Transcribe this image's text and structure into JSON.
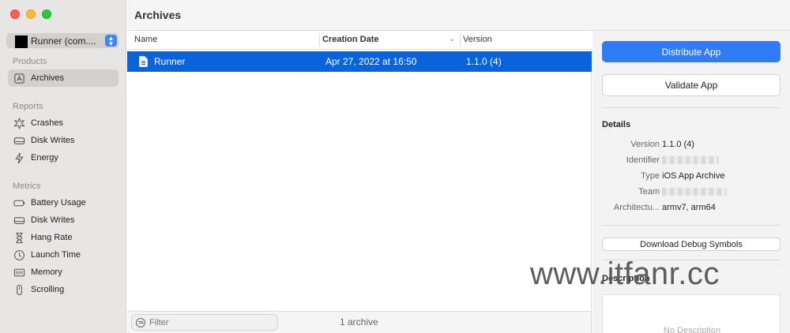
{
  "window": {
    "title": "Archives"
  },
  "sidebar": {
    "app_selector": {
      "name": "Runner (com...."
    },
    "sections": {
      "products": "Products",
      "reports": "Reports",
      "metrics": "Metrics"
    },
    "products_items": [
      {
        "label": "Archives",
        "icon": "archive-icon",
        "selected": true
      }
    ],
    "reports_items": [
      {
        "label": "Crashes",
        "icon": "crash-icon"
      },
      {
        "label": "Disk Writes",
        "icon": "disk-icon"
      },
      {
        "label": "Energy",
        "icon": "energy-icon"
      }
    ],
    "metrics_items": [
      {
        "label": "Battery Usage",
        "icon": "battery-icon"
      },
      {
        "label": "Disk Writes",
        "icon": "disk-icon"
      },
      {
        "label": "Hang Rate",
        "icon": "hourglass-icon"
      },
      {
        "label": "Launch Time",
        "icon": "clock-icon"
      },
      {
        "label": "Memory",
        "icon": "memory-icon"
      },
      {
        "label": "Scrolling",
        "icon": "scroll-icon"
      }
    ]
  },
  "list": {
    "columns": {
      "name": "Name",
      "date": "Creation Date",
      "version": "Version"
    },
    "rows": [
      {
        "name": "Runner",
        "date": "Apr 27, 2022 at 16:50",
        "version": "1.1.0 (4)",
        "selected": true
      }
    ]
  },
  "bottom_bar": {
    "filter_placeholder": "Filter",
    "count": "1 archive"
  },
  "inspector": {
    "distribute_label": "Distribute App",
    "validate_label": "Validate App",
    "details_title": "Details",
    "details": {
      "version_key": "Version",
      "version_val": "1.1.0 (4)",
      "identifier_key": "Identifier",
      "type_key": "Type",
      "type_val": "iOS App Archive",
      "team_key": "Team",
      "arch_key": "Architectu...",
      "arch_val": "armv7, arm64"
    },
    "download_symbols_label": "Download Debug Symbols",
    "description_title": "Description",
    "description_empty": "No Description"
  },
  "watermark": "www.itfanr.cc",
  "colors": {
    "accent": "#2f7cf6",
    "selection": "#0a63d8",
    "sidebar_bg": "#e8e5e5"
  }
}
